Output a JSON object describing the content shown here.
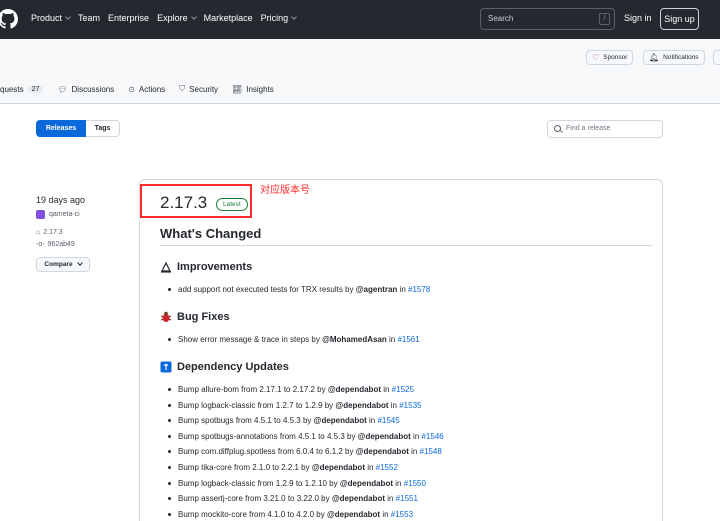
{
  "header": {
    "nav": [
      "Product",
      "Team",
      "Enterprise",
      "Explore",
      "Marketplace",
      "Pricing"
    ],
    "nav_has_chevron": [
      true,
      false,
      false,
      true,
      false,
      true
    ],
    "search_placeholder": "Search",
    "search_shortcut": "/",
    "signin": "Sign in",
    "signup": "Sign up"
  },
  "repo": {
    "title_tail": "t",
    "sponsor": "Sponsor",
    "notifications": "Notifications",
    "tabs": [
      {
        "label": "quests",
        "count": "27"
      },
      {
        "label": "Discussions"
      },
      {
        "label": "Actions"
      },
      {
        "label": "Security"
      },
      {
        "label": "Insights"
      }
    ]
  },
  "releases": {
    "tab_releases": "Releases",
    "tab_tags": "Tags",
    "find_placeholder": "Find a release"
  },
  "release": {
    "date": "19 days ago",
    "author": "qameta-ci",
    "tag": "2.17.3",
    "commit": "962ab49",
    "compare": "Compare",
    "version": "2.17.3",
    "latest": "Latest",
    "annotation": "对应版本号",
    "whats_changed": "What's Changed",
    "sections": [
      {
        "title": "Improvements",
        "icon": "memo-icon",
        "items": [
          {
            "text": "add support not executed tests for TRX results by ",
            "user": "@agentran",
            "pr": "#1578"
          }
        ]
      },
      {
        "title": "Bug Fixes",
        "icon": "bug-icon",
        "items": [
          {
            "text": "Show error message & trace in steps by ",
            "user": "@MohamedAsan",
            "pr": "#1561"
          }
        ]
      },
      {
        "title": "Dependency Updates",
        "icon": "box-icon",
        "items": [
          {
            "text": "Bump allure-bom from 2.17.1 to 2.17.2 by ",
            "user": "@dependabot",
            "pr": "#1525"
          },
          {
            "text": "Bump logback-classic from 1.2.7 to 1.2.9 by ",
            "user": "@dependabot",
            "pr": "#1535"
          },
          {
            "text": "Bump spotbugs from 4.5.1 to 4.5.3 by ",
            "user": "@dependabot",
            "pr": "#1545"
          },
          {
            "text": "Bump spotbugs-annotations from 4.5.1 to 4.5.3 by ",
            "user": "@dependabot",
            "pr": "#1546"
          },
          {
            "text": "Bump com.diffplug.spotless from 6.0.4 to 6.1.2 by ",
            "user": "@dependabot",
            "pr": "#1548"
          },
          {
            "text": "Bump tika-core from 2.1.0 to 2.2.1 by ",
            "user": "@dependabot",
            "pr": "#1552"
          },
          {
            "text": "Bump logback-classic from 1.2.9 to 1.2.10 by ",
            "user": "@dependabot",
            "pr": "#1550"
          },
          {
            "text": "Bump assertj-core from 3.21.0 to 3.22.0 by ",
            "user": "@dependabot",
            "pr": "#1551"
          },
          {
            "text": "Bump mockito-core from 4.1.0 to 4.2.0 by ",
            "user": "@dependabot",
            "pr": "#1553"
          }
        ]
      }
    ]
  },
  "colors": {
    "header_bg": "#24292f",
    "accent": "#0969da",
    "latest": "#1a7f37",
    "annotation": "#ff2a2a"
  }
}
